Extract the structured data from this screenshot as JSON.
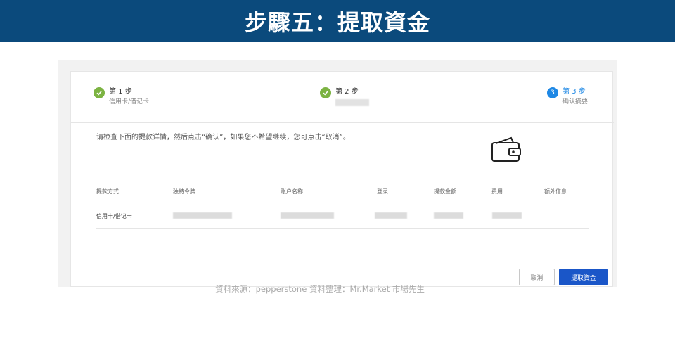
{
  "banner": {
    "title": "步驟五：提取資金"
  },
  "stepper": {
    "steps": [
      {
        "number": "✓",
        "title": "第 1 步",
        "subtitle": "信用卡/借记卡",
        "state": "done"
      },
      {
        "number": "✓",
        "title": "第 2 步",
        "subtitle": "",
        "state": "done"
      },
      {
        "number": "3",
        "title": "第 3 步",
        "subtitle": "确认摘要",
        "state": "active"
      }
    ]
  },
  "instruction": "请检查下面的提款详情，然后点击“确认”，如果您不希望继续，您可点击“取消”。",
  "icons": {
    "wallet": "wallet-icon",
    "check": "check-icon"
  },
  "table": {
    "headers": [
      "提款方式",
      "独特令牌",
      "账户名称",
      "登录",
      "提款金额",
      "费用",
      "额外信息"
    ],
    "row": {
      "method": "信用卡/借记卡"
    }
  },
  "buttons": {
    "cancel": "取消",
    "submit": "提取資金"
  },
  "source": "資料來源：pepperstone    資料整理：Mr.Market  市場先生",
  "colors": {
    "banner": "#0b4a7c",
    "done": "#7cb342",
    "active": "#1e88e5",
    "primary": "#1a56c8"
  }
}
